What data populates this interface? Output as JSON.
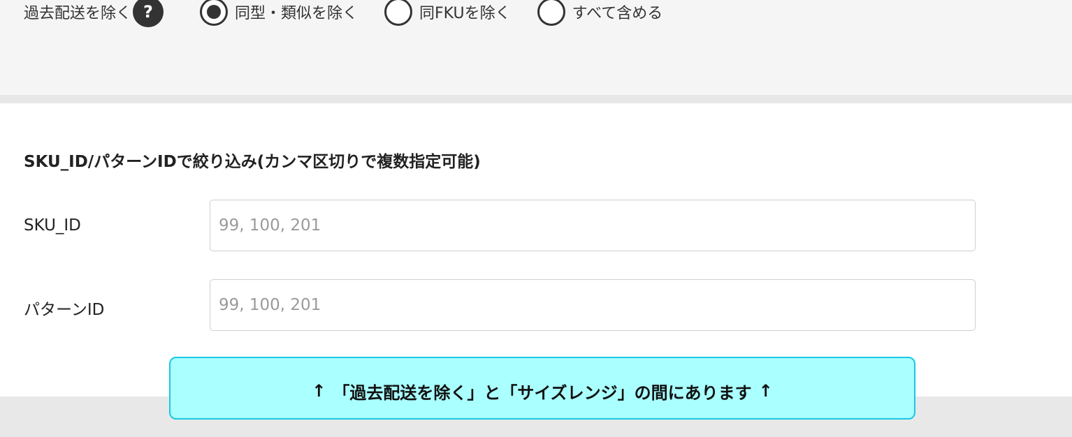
{
  "exclude_past": {
    "label": "過去配送を除く",
    "help_icon": "?",
    "options": [
      {
        "label": "同型・類似を除く",
        "selected": true
      },
      {
        "label": "同FKUを除く",
        "selected": false
      },
      {
        "label": "すべて含める",
        "selected": false
      }
    ]
  },
  "filter": {
    "title": "SKU_ID/パターンIDで絞り込み(カンマ区切りで複数指定可能)",
    "sku_id": {
      "label": "SKU_ID",
      "value": "",
      "placeholder": "99, 100, 201"
    },
    "pattern_id": {
      "label": "パターンID",
      "value": "",
      "placeholder": "99, 100, 201"
    }
  },
  "callout": {
    "arrow_left": "↑",
    "text": "「過去配送を除く」と「サイズレンジ」の間にあります",
    "arrow_right": "↑"
  },
  "colors": {
    "callout_background": "#aaffff",
    "callout_border": "#19c7e6",
    "radio": "#333333"
  }
}
